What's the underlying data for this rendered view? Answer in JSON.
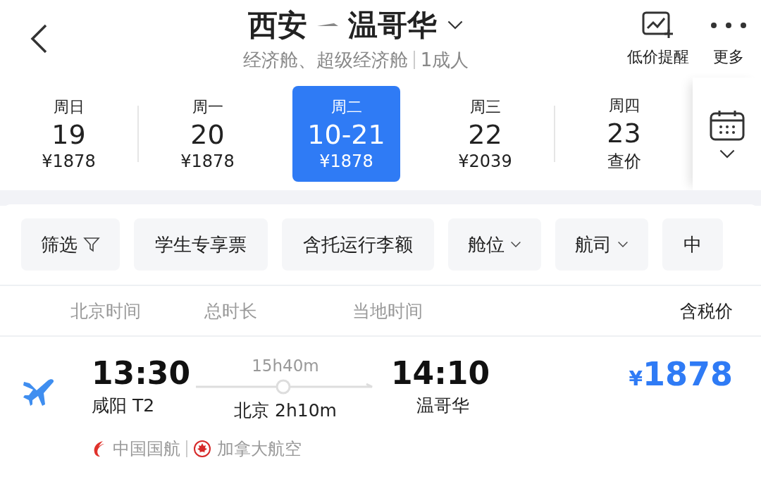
{
  "header": {
    "origin": "西安",
    "destination": "温哥华",
    "subtitle": "经济舱、超级经济舱",
    "passengers": "1成人",
    "actions": [
      {
        "kind": "alert",
        "label": "低价提醒"
      },
      {
        "kind": "more",
        "label": "更多"
      }
    ]
  },
  "dates": [
    {
      "weekday": "周日",
      "date": "19",
      "price": "¥1878",
      "selected": false
    },
    {
      "weekday": "周一",
      "date": "20",
      "price": "¥1878",
      "selected": false
    },
    {
      "weekday": "周二",
      "date": "10-21",
      "price": "¥1878",
      "selected": true
    },
    {
      "weekday": "周三",
      "date": "22",
      "price": "¥2039",
      "selected": false
    },
    {
      "weekday": "周四",
      "date": "23",
      "price": "查价",
      "selected": false
    }
  ],
  "filters": [
    {
      "kind": "filter",
      "label": "筛选"
    },
    {
      "kind": "plain",
      "label": "学生专享票"
    },
    {
      "kind": "plain",
      "label": "含托运行李额"
    },
    {
      "kind": "dropdown",
      "label": "舱位"
    },
    {
      "kind": "dropdown",
      "label": "航司"
    },
    {
      "kind": "plain",
      "label": "中"
    }
  ],
  "columns": [
    "北京时间",
    "总时长",
    "当地时间",
    "含税价"
  ],
  "flights": [
    {
      "depart_time": "13:30",
      "depart_airport": "咸阳 T2",
      "duration": "15h40m",
      "stopover": "北京 2h10m",
      "arrive_time": "14:10",
      "arrive_city": "温哥华",
      "currency": "¥",
      "price": "1878",
      "airlines": [
        {
          "kind": "china",
          "name": "中国国航"
        },
        {
          "kind": "maple",
          "name": "加拿大航空"
        }
      ]
    }
  ]
}
